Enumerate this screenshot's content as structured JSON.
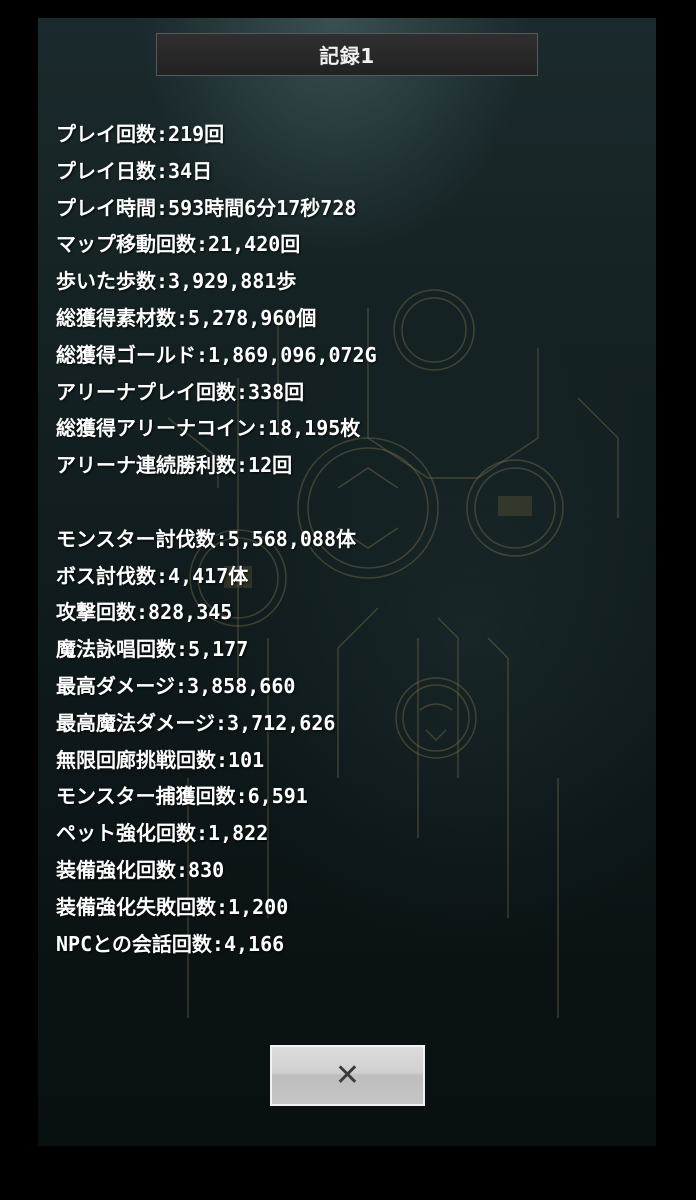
{
  "dialog": {
    "title": "記録1",
    "close_icon": "✕",
    "close_icon_name": "close-icon"
  },
  "stats": [
    "プレイ回数:219回",
    "プレイ日数:34日",
    "プレイ時間:593時間6分17秒728",
    "マップ移動回数:21,420回",
    "歩いた歩数:3,929,881歩",
    "総獲得素材数:5,278,960個",
    "総獲得ゴールド:1,869,096,072G",
    "アリーナプレイ回数:338回",
    "総獲得アリーナコイン:18,195枚",
    "アリーナ連続勝利数:12回",
    "",
    "モンスター討伐数:5,568,088体",
    "ボス討伐数:4,417体",
    "攻撃回数:828,345",
    "魔法詠唱回数:5,177",
    "最高ダメージ:3,858,660",
    "最高魔法ダメージ:3,712,626",
    "無限回廊挑戦回数:101",
    "モンスター捕獲回数:6,591",
    "ペット強化回数:1,822",
    "装備強化回数:830",
    "装備強化失敗回数:1,200",
    "NPCとの会話回数:4,166"
  ],
  "colors": {
    "panel_bg": "#142123",
    "text": "#ffffff",
    "ornament_gold": "#8a7a4a"
  }
}
